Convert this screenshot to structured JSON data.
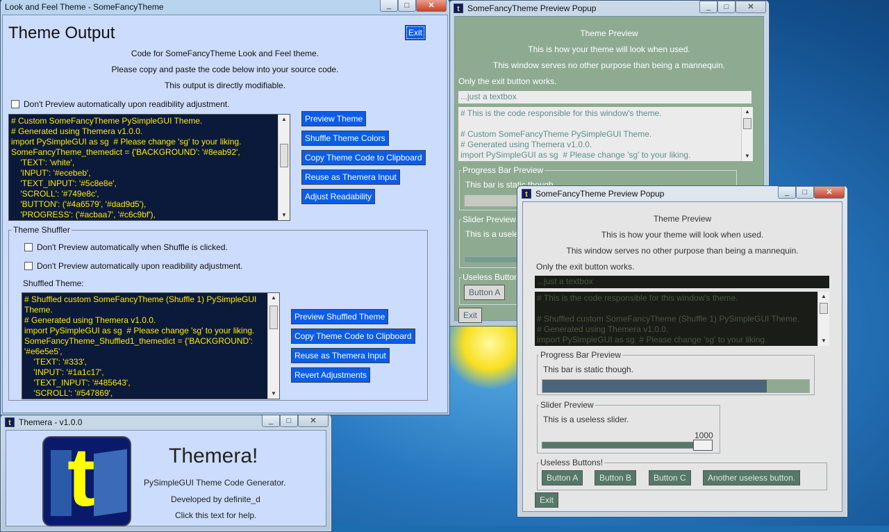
{
  "theme_output_window": {
    "title": "Look and Feel Theme - SomeFancyTheme",
    "heading": "Theme Output",
    "exit_label": "Exit",
    "line1": "Code for SomeFancyTheme Look and Feel theme.",
    "line2": "Please copy and paste the code below into your source code.",
    "line3": "This output is directly modifiable.",
    "dont_preview_readability": "Don't Preview automatically upon readibility adjustment.",
    "code_lines": [
      "# Custom SomeFancyTheme PySimpleGUI Theme.",
      "# Generated using Themera v1.0.0.",
      "import PySimpleGUI as sg  # Please change 'sg' to your liking.",
      "SomeFancyTheme_themedict = {'BACKGROUND': '#8eab92',",
      "    'TEXT': 'white',",
      "    'INPUT': '#ecebeb',",
      "    'TEXT_INPUT': '#5c8e8e',",
      "    'SCROLL': '#749e8c',",
      "    'BUTTON': ('#4a6579', '#dad9d5'),",
      "    'PROGRESS': ('#acbaa7', '#c6c9bf'),"
    ],
    "buttons": [
      "Preview Theme",
      "Shuffle Theme Colors",
      "Copy Theme Code to Clipboard",
      "Reuse as Themera Input",
      "Adjust Readability"
    ],
    "shuffler_label": "Theme Shuffler",
    "dont_preview_shuffle": "Don't Preview automatically when Shuffle is clicked.",
    "dont_preview_shuffle_readability": "Don't Preview automatically upon readibility adjustment.",
    "shuffled_theme_label": "Shuffled Theme:",
    "shuffled_code_lines": [
      "# Shuffled custom SomeFancyTheme (Shuffle 1) PySimpleGUI",
      "Theme.",
      "# Generated using Themera v1.0.0.",
      "import PySimpleGUI as sg  # Please change 'sg' to your liking.",
      "SomeFancyTheme_Shuffled1_themedict = {'BACKGROUND':",
      "'#e6e5e5',",
      "    'TEXT': '#333',",
      "    'INPUT': '#1a1c17',",
      "    'TEXT_INPUT': '#485643',",
      "    'SCROLL': '#547869',"
    ],
    "shuffle_buttons": [
      "Preview Shuffled Theme",
      "Copy Theme Code to Clipboard",
      "Reuse as Themera Input",
      "Revert Adjustments"
    ]
  },
  "themera_window": {
    "title": "Themera - v1.0.0",
    "logo_letter": "t",
    "heading": "Themera!",
    "subtitle": "PySimpleGUI Theme Code Generator.",
    "developer": "Developed by definite_d",
    "help": "Click this text for help."
  },
  "preview_back": {
    "title": "SomeFancyTheme Preview Popup",
    "theme_preview": "Theme Preview",
    "line1": "This is how your theme will look when used.",
    "line2": "This window serves no other purpose than being a mannequin.",
    "only_exit": "Only the exit button works.",
    "textbox": "...just a textbox",
    "code_lines": [
      "# This is the code responsible for this window's theme.",
      "",
      "# Custom SomeFancyTheme PySimpleGUI Theme.",
      "# Generated using Themera v1.0.0.",
      "import PySimpleGUI as sg  # Please change 'sg' to your liking."
    ],
    "progress_label": "Progress Bar Preview",
    "progress_text": "This bar is static though.",
    "slider_label": "Slider Preview",
    "slider_text": "This is a useless slider.",
    "buttons_label": "Useless Buttons!",
    "button_a": "Button A",
    "exit_label": "Exit"
  },
  "preview_front": {
    "title": "SomeFancyTheme Preview Popup",
    "theme_preview": "Theme Preview",
    "line1": "This is how your theme will look when used.",
    "line2": "This window serves no other purpose than being a mannequin.",
    "only_exit": "Only the exit button works.",
    "textbox": "...just a textbox",
    "code_lines": [
      "# This is the code responsible for this window's theme.",
      "",
      "# Shuffled custom SomeFancyTheme (Shuffle 1) PySimpleGUI Theme.",
      "# Generated using Themera v1.0.0.",
      "import PySimpleGUI as sg  # Please change 'sg' to your liking."
    ],
    "progress_label": "Progress Bar Preview",
    "progress_text": "This bar is static though.",
    "progress_fraction": 0.84,
    "slider_label": "Slider Preview",
    "slider_text": "This is a useless slider.",
    "slider_value": "1000",
    "buttons_label": "Useless Buttons!",
    "buttons": [
      "Button A",
      "Button B",
      "Button C",
      "Another useless button."
    ],
    "exit_label": "Exit"
  },
  "colors": {
    "output_bg": "#ccdcfc",
    "code_bg": "#0b1a3a",
    "code_fg": "#ffea00",
    "accent_button": "#0a5de8",
    "preview_back_bg": "#8eab92",
    "preview_front_bg": "#e6e5e5",
    "preview_front_input": "#1a1c17",
    "preview_front_button": "#547869"
  }
}
